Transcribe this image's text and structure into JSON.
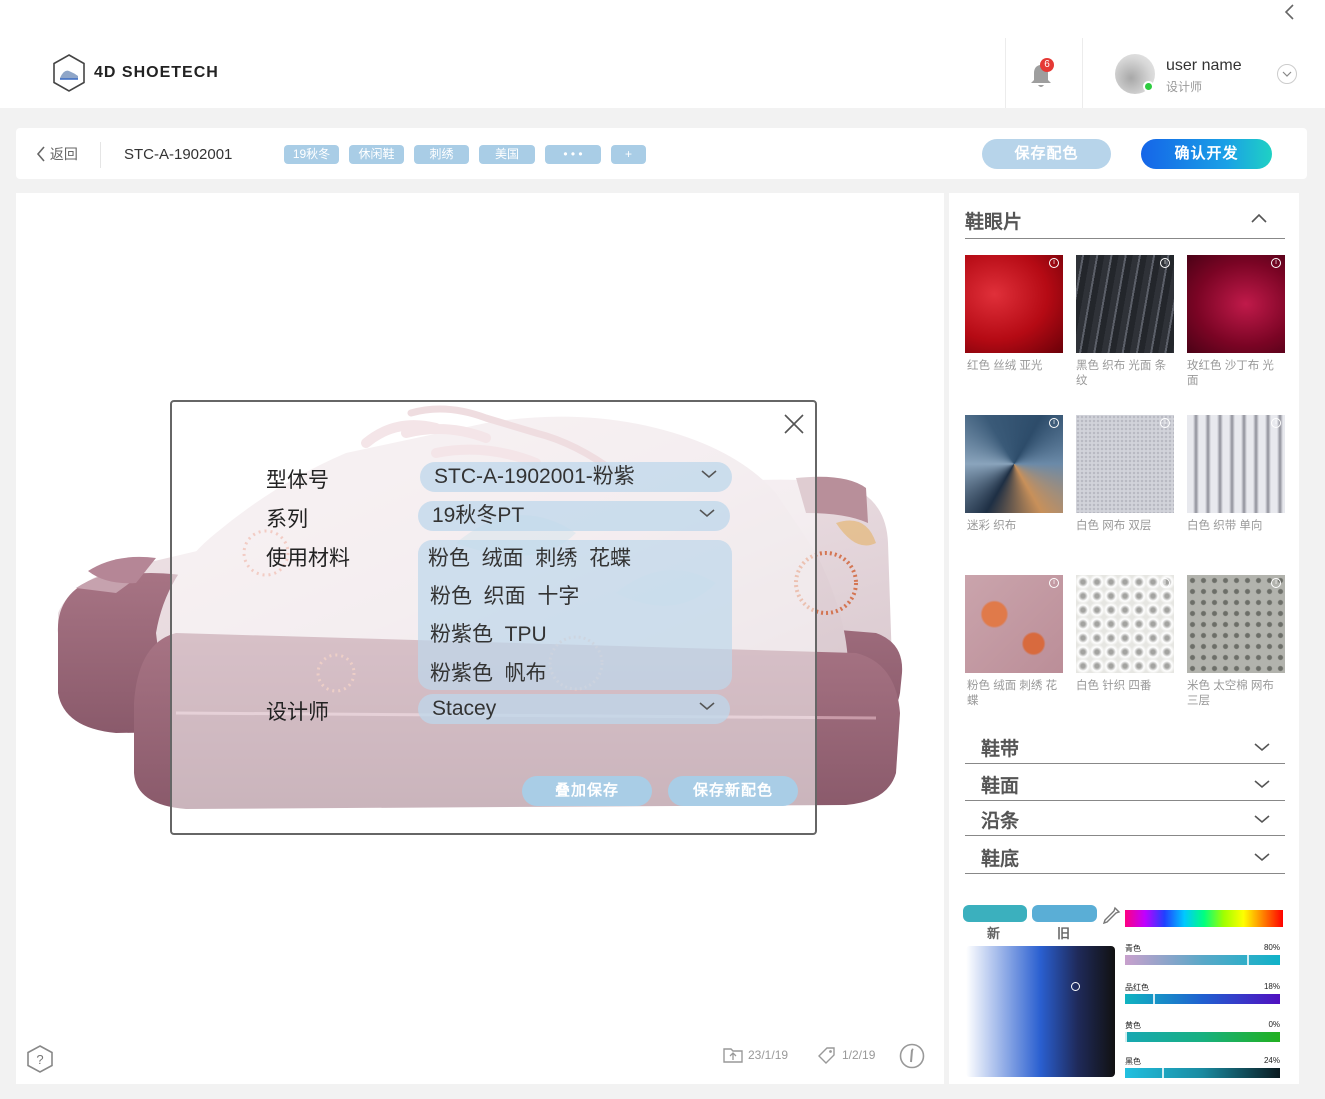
{
  "header": {
    "logo_text": "4D SHOETECH",
    "notification_count": "6",
    "user_name": "user name",
    "user_role": "设计师"
  },
  "toolbar": {
    "back_label": "返回",
    "style_code": "STC-A-1902001",
    "tags": [
      "19秋冬",
      "休闲鞋",
      "刺绣",
      "美国",
      "• • •",
      "+"
    ],
    "save_color_label": "保存配色",
    "confirm_label": "确认开发"
  },
  "dialog": {
    "model_label": "型体号",
    "model_value": "STC-A-1902001-粉紫",
    "series_label": "系列",
    "series_value": "19秋冬PT",
    "materials_label": "使用材料",
    "materials": [
      "粉色  绒面  刺绣  花蝶",
      "粉色  织面  十字",
      "粉紫色  TPU",
      "粉紫色  帆布"
    ],
    "designer_label": "设计师",
    "designer_value": "Stacey",
    "overlay_save_label": "叠加保存",
    "save_new_label": "保存新配色"
  },
  "viewer": {
    "created_date": "23/1/19",
    "edited_date": "1/2/19"
  },
  "panel": {
    "section_title": "鞋眼片",
    "swatches": [
      {
        "label": "红色  丝绒  亚光",
        "color": "#c2101a"
      },
      {
        "label": "黑色  织布  光面 条纹",
        "color": "#3a3d44"
      },
      {
        "label": "玫红色  沙丁布 光面",
        "color": "#9a0c35"
      },
      {
        "label": "迷彩  织布",
        "color": "#3a5a78"
      },
      {
        "label": "白色  网布  双层",
        "color": "#cfd0d8"
      },
      {
        "label": "白色  织带  单向",
        "color": "#a8a9b2"
      },
      {
        "label": "粉色  绒面  刺绣 花蝶",
        "color": "#c49aa0"
      },
      {
        "label": "白色  针织    四番",
        "color": "#f2f2ef"
      },
      {
        "label": "米色  太空棉  网布 三层",
        "color": "#a9aaa4"
      }
    ],
    "accordion": [
      "鞋带",
      "鞋面",
      "沿条",
      "鞋底"
    ]
  },
  "color_picker": {
    "new_label": "新",
    "old_label": "旧",
    "new_color": "#3bb0be",
    "old_color": "#5aaed6",
    "sliders": [
      {
        "name": "青色",
        "value": "80%",
        "fraction": 0.8
      },
      {
        "name": "品红色",
        "value": "18%",
        "fraction": 0.18
      },
      {
        "name": "黄色",
        "value": "0%",
        "fraction": 0.0
      },
      {
        "name": "黑色",
        "value": "24%",
        "fraction": 0.24
      }
    ]
  }
}
